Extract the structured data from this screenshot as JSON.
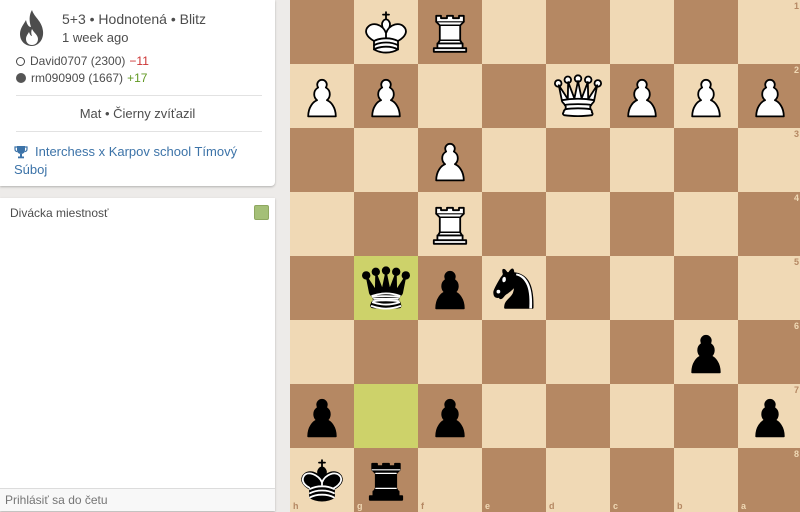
{
  "game": {
    "title": "5+3 • Hodnotená • Blitz",
    "date": "1 week ago",
    "white_player": {
      "name": "David0707 (2300)",
      "rating_diff": "−11"
    },
    "black_player": {
      "name": "rm090909 (1667)",
      "rating_diff": "+17"
    },
    "status": "Mat • Čierny zvíťazil",
    "tournament": "Interchess x Karpov school Tímový Súboj"
  },
  "chat": {
    "title": "Divácka miestnosť",
    "input_placeholder": "Prihlásiť sa do četu"
  },
  "board": {
    "orientation": "black",
    "colors": {
      "light": "#f0d9b5",
      "dark": "#b58863",
      "highlight_light": "#cdd26a",
      "highlight_dark": "#aaa23a"
    },
    "files": [
      "h",
      "g",
      "f",
      "e",
      "d",
      "c",
      "b",
      "a"
    ],
    "ranks": [
      "1",
      "2",
      "3",
      "4",
      "5",
      "6",
      "7",
      "8"
    ],
    "pieces": [
      {
        "square": "g1",
        "color": "white",
        "type": "king"
      },
      {
        "square": "f1",
        "color": "white",
        "type": "rook"
      },
      {
        "square": "h2",
        "color": "white",
        "type": "pawn"
      },
      {
        "square": "g2",
        "color": "white",
        "type": "pawn"
      },
      {
        "square": "d2",
        "color": "white",
        "type": "queen"
      },
      {
        "square": "c2",
        "color": "white",
        "type": "pawn"
      },
      {
        "square": "b2",
        "color": "white",
        "type": "pawn"
      },
      {
        "square": "a2",
        "color": "white",
        "type": "pawn"
      },
      {
        "square": "f3",
        "color": "white",
        "type": "pawn"
      },
      {
        "square": "f4",
        "color": "white",
        "type": "rook"
      },
      {
        "square": "g5",
        "color": "black",
        "type": "queen"
      },
      {
        "square": "f5",
        "color": "black",
        "type": "pawn"
      },
      {
        "square": "e5",
        "color": "black",
        "type": "knight"
      },
      {
        "square": "b6",
        "color": "black",
        "type": "pawn"
      },
      {
        "square": "h7",
        "color": "black",
        "type": "pawn"
      },
      {
        "square": "f7",
        "color": "black",
        "type": "pawn"
      },
      {
        "square": "a7",
        "color": "black",
        "type": "pawn"
      },
      {
        "square": "h8",
        "color": "black",
        "type": "king"
      },
      {
        "square": "g8",
        "color": "black",
        "type": "rook"
      }
    ],
    "last_move": [
      "g7",
      "g5"
    ]
  }
}
